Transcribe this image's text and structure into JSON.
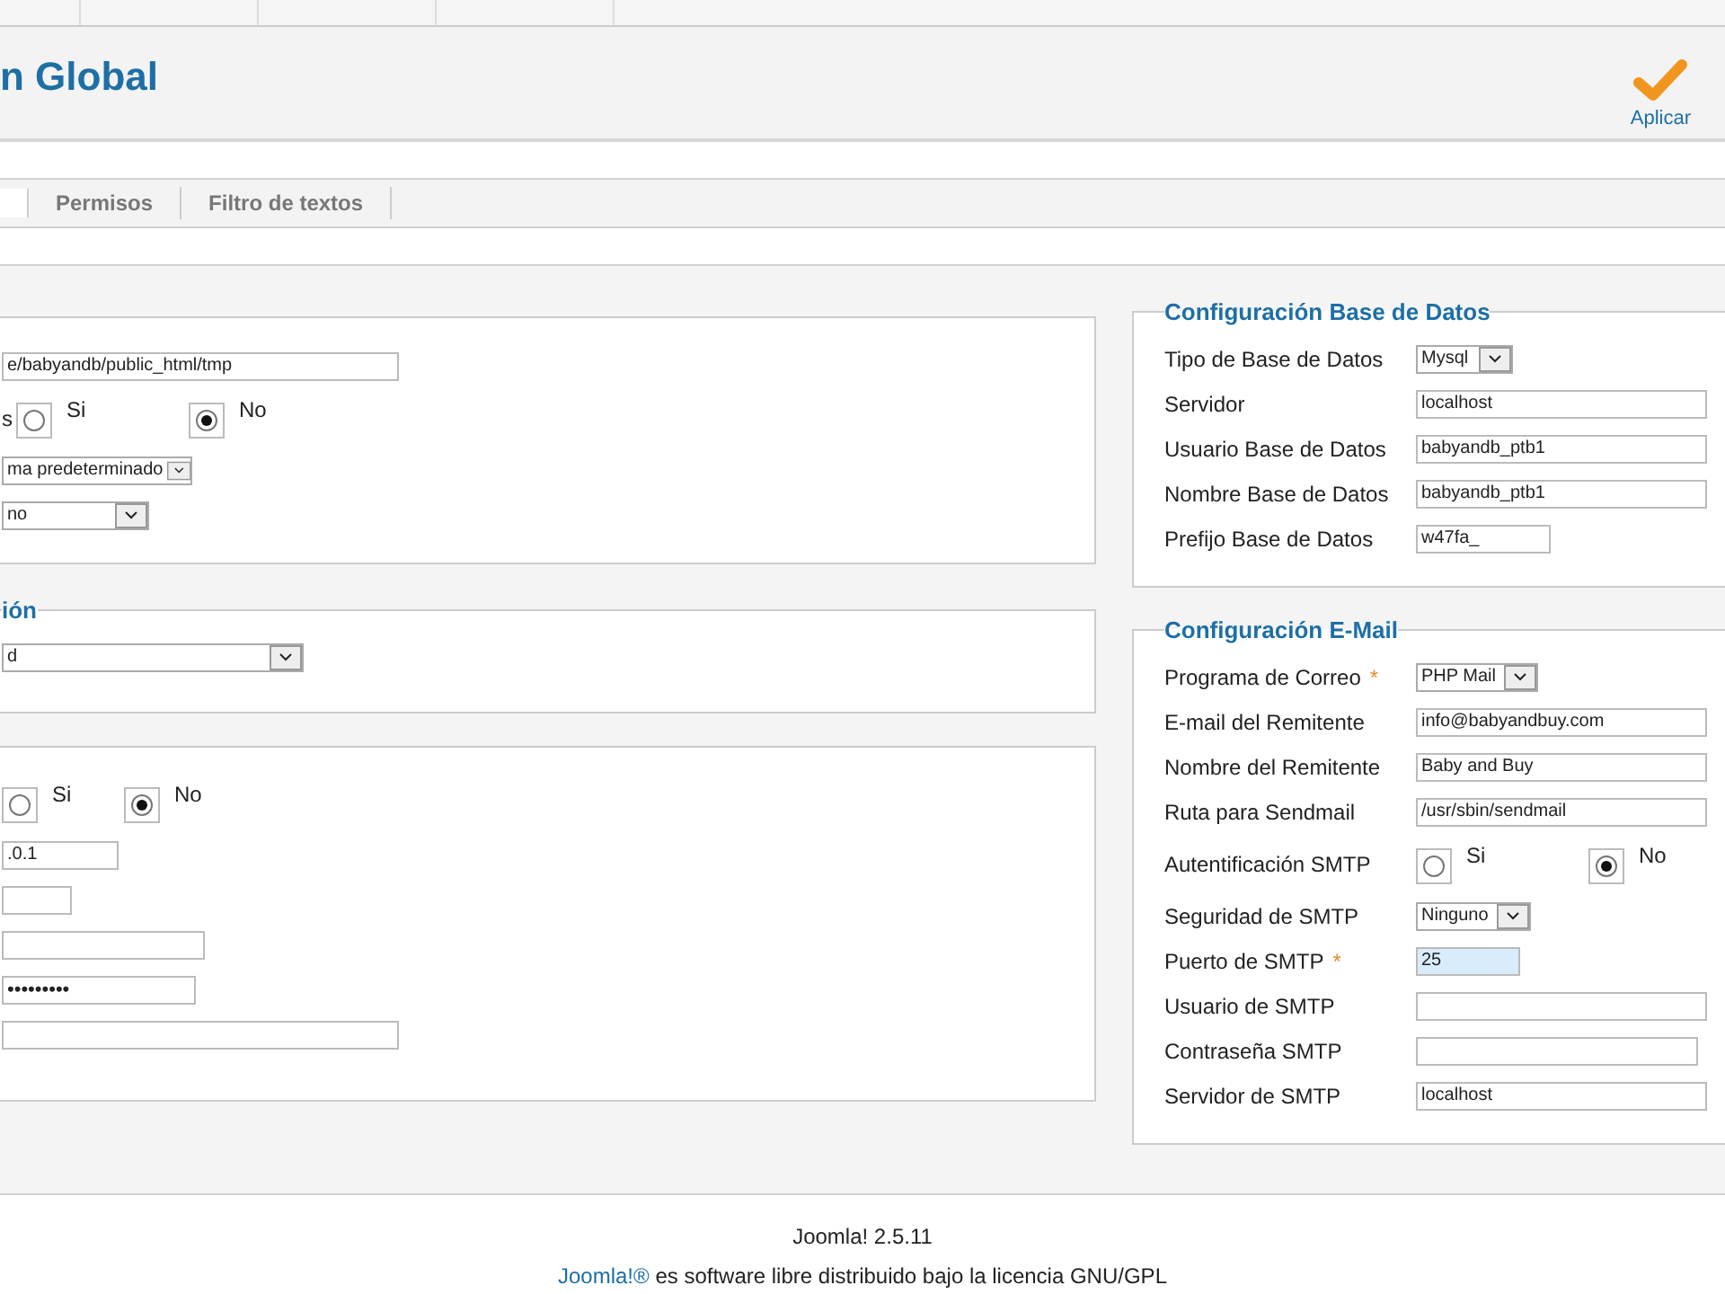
{
  "header": {
    "title": "n Global",
    "toolbar": [
      {
        "label": "Aplicar"
      }
    ]
  },
  "tabs": [
    {
      "label": "Permisos",
      "selected": false
    },
    {
      "label": "Filtro de textos",
      "selected": false
    }
  ],
  "left_sections": [
    {
      "rows": [
        {
          "kind": "text",
          "value": "e/babyandb/public_html/tmp",
          "focused": false
        },
        {
          "kind": "radio",
          "label": "s",
          "options": [
            {
              "label": "Si",
              "selected": false
            },
            {
              "label": "No",
              "selected": true
            }
          ]
        },
        {
          "kind": "select",
          "value": "ma predeterminado"
        },
        {
          "kind": "select",
          "value": "no"
        }
      ]
    },
    {
      "legend": "ión",
      "rows": [
        {
          "kind": "select",
          "value": "d"
        }
      ]
    },
    {
      "rows": [
        {
          "kind": "radio",
          "options": [
            {
              "label": "Si",
              "selected": false
            },
            {
              "label": "No",
              "selected": true
            }
          ]
        },
        {
          "kind": "text",
          "value": ".0.1",
          "focused": false
        },
        {
          "kind": "text",
          "value": "",
          "focused": false
        },
        {
          "kind": "text",
          "value": "",
          "focused": false
        },
        {
          "kind": "password",
          "value": "•••••••••",
          "focused": false
        },
        {
          "kind": "text",
          "value": "",
          "focused": false
        }
      ]
    }
  ],
  "right_sections": [
    {
      "legend": "Configuración Base de Datos",
      "rows": [
        {
          "label": "Tipo de Base de Datos",
          "kind": "select",
          "value": "Mysql"
        },
        {
          "label": "Servidor",
          "kind": "text",
          "value": "localhost",
          "focused": false
        },
        {
          "label": "Usuario Base de Datos",
          "kind": "text",
          "value": "babyandb_ptb1",
          "focused": false
        },
        {
          "label": "Nombre Base de Datos",
          "kind": "text",
          "value": "babyandb_ptb1",
          "focused": false
        },
        {
          "label": "Prefijo Base de Datos",
          "kind": "text",
          "value": "w47fa_",
          "focused": false
        }
      ]
    },
    {
      "legend": "Configuración E-Mail",
      "rows": [
        {
          "label": "Programa de Correo",
          "required_mark": "*",
          "kind": "select",
          "value": "PHP Mail"
        },
        {
          "label": "E-mail del Remitente",
          "kind": "text",
          "value": "info@babyandbuy.com",
          "focused": false
        },
        {
          "label": "Nombre del Remitente",
          "kind": "text",
          "value": "Baby and Buy",
          "focused": false
        },
        {
          "label": "Ruta para Sendmail",
          "kind": "text",
          "value": "/usr/sbin/sendmail",
          "focused": false
        },
        {
          "label": "Autentificación SMTP",
          "kind": "radio",
          "options": [
            {
              "label": "Si",
              "selected": false
            },
            {
              "label": "No",
              "selected": true
            }
          ]
        },
        {
          "label": "Seguridad de SMTP",
          "kind": "select",
          "value": "Ninguno"
        },
        {
          "label": "Puerto de SMTP",
          "required_mark": "*",
          "kind": "text",
          "value": "25",
          "focused": true
        },
        {
          "label": "Usuario de SMTP",
          "kind": "text",
          "value": "",
          "focused": false
        },
        {
          "label": "Contraseña SMTP",
          "kind": "password",
          "value": "",
          "focused": false
        },
        {
          "label": "Servidor de SMTP",
          "kind": "text",
          "value": "localhost",
          "focused": false
        }
      ]
    }
  ],
  "footer": {
    "version": "Joomla! 2.5.11",
    "link": "Joomla!®",
    "license": "es software libre distribuido bajo la licencia GNU/GPL"
  }
}
